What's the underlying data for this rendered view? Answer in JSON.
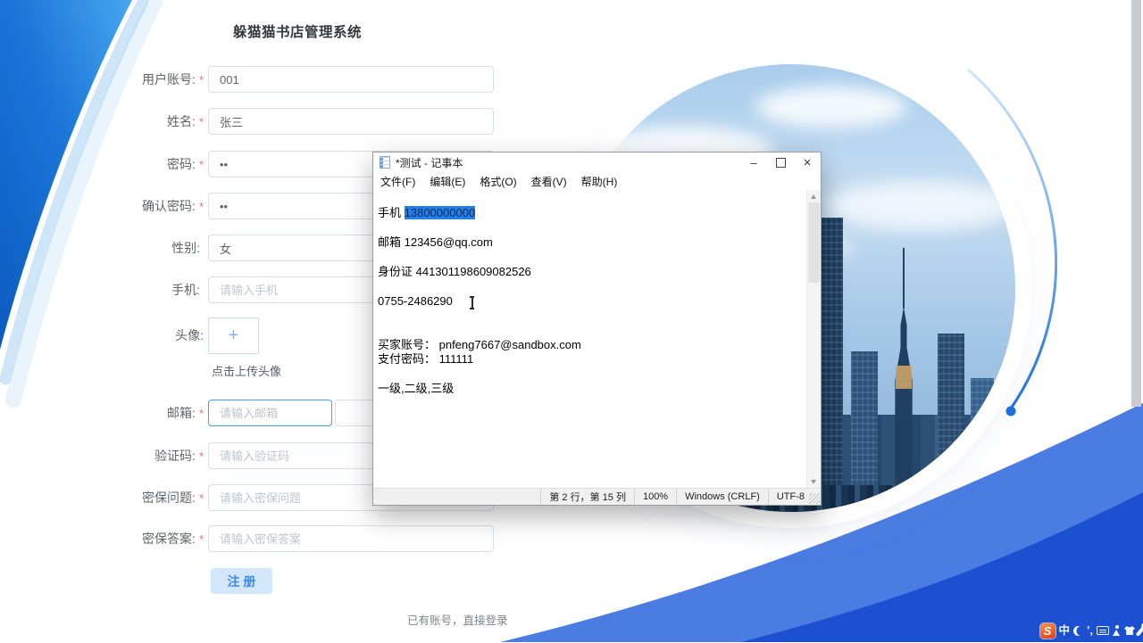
{
  "app": {
    "title": "躲猫猫书店管理系统",
    "register_button": "注 册",
    "login_link": "已有账号，直接登录",
    "upload_plus": "+",
    "upload_hint": "点击上传头像"
  },
  "form": {
    "fields": [
      {
        "label": "用户账号:",
        "star": "*",
        "value": "001"
      },
      {
        "label": "姓名:",
        "star": "*",
        "value": "张三"
      },
      {
        "label": "密码:",
        "star": "*",
        "value": "••"
      },
      {
        "label": "确认密码:",
        "star": "*",
        "value": "••"
      },
      {
        "label": "性别:",
        "star": "",
        "value": "女"
      },
      {
        "label": "手机:",
        "star": "",
        "placeholder": "请输入手机"
      },
      {
        "label": "头像:",
        "star": ""
      },
      {
        "label": "邮箱:",
        "star": "*",
        "placeholder": "请输入邮箱"
      },
      {
        "label": "验证码:",
        "star": "*",
        "placeholder": "请输入验证码"
      },
      {
        "label": "密保问题:",
        "star": "*",
        "placeholder": "请输入密保问题"
      },
      {
        "label": "密保答案:",
        "star": "*",
        "placeholder": "请输入密保答案"
      }
    ]
  },
  "notepad": {
    "title": "*测试 - 记事本",
    "menu": [
      "文件(F)",
      "编辑(E)",
      "格式(O)",
      "查看(V)",
      "帮助(H)"
    ],
    "controls": {
      "minimize": "–",
      "close": "×"
    },
    "body": {
      "first_line": "",
      "phone_prefix": "手机 ",
      "phone_selected": "13800000000",
      "rest_lines": [
        "",
        "邮箱 123456@qq.com",
        "",
        "身份证 441301198609082526",
        "",
        "0755-2486290",
        "",
        "",
        "买家账号： pnfeng7667@sandbox.com",
        "支付密码： 111111",
        "",
        "一级,二级,三级"
      ]
    },
    "statusbar": {
      "line_col": "第 2 行，第 15 列",
      "zoom": "100%",
      "line_ending": "Windows (CRLF)",
      "encoding": "UTF-8"
    }
  },
  "ime": {
    "logo": "S",
    "lang": "中",
    "punct": "’,"
  },
  "colors": {
    "accent": "#409eff",
    "required_star": "#f56c6c",
    "selection_bg": "#2180ec",
    "curve_light": "#4a7ce2",
    "curve_dark": "#1c50d0"
  }
}
